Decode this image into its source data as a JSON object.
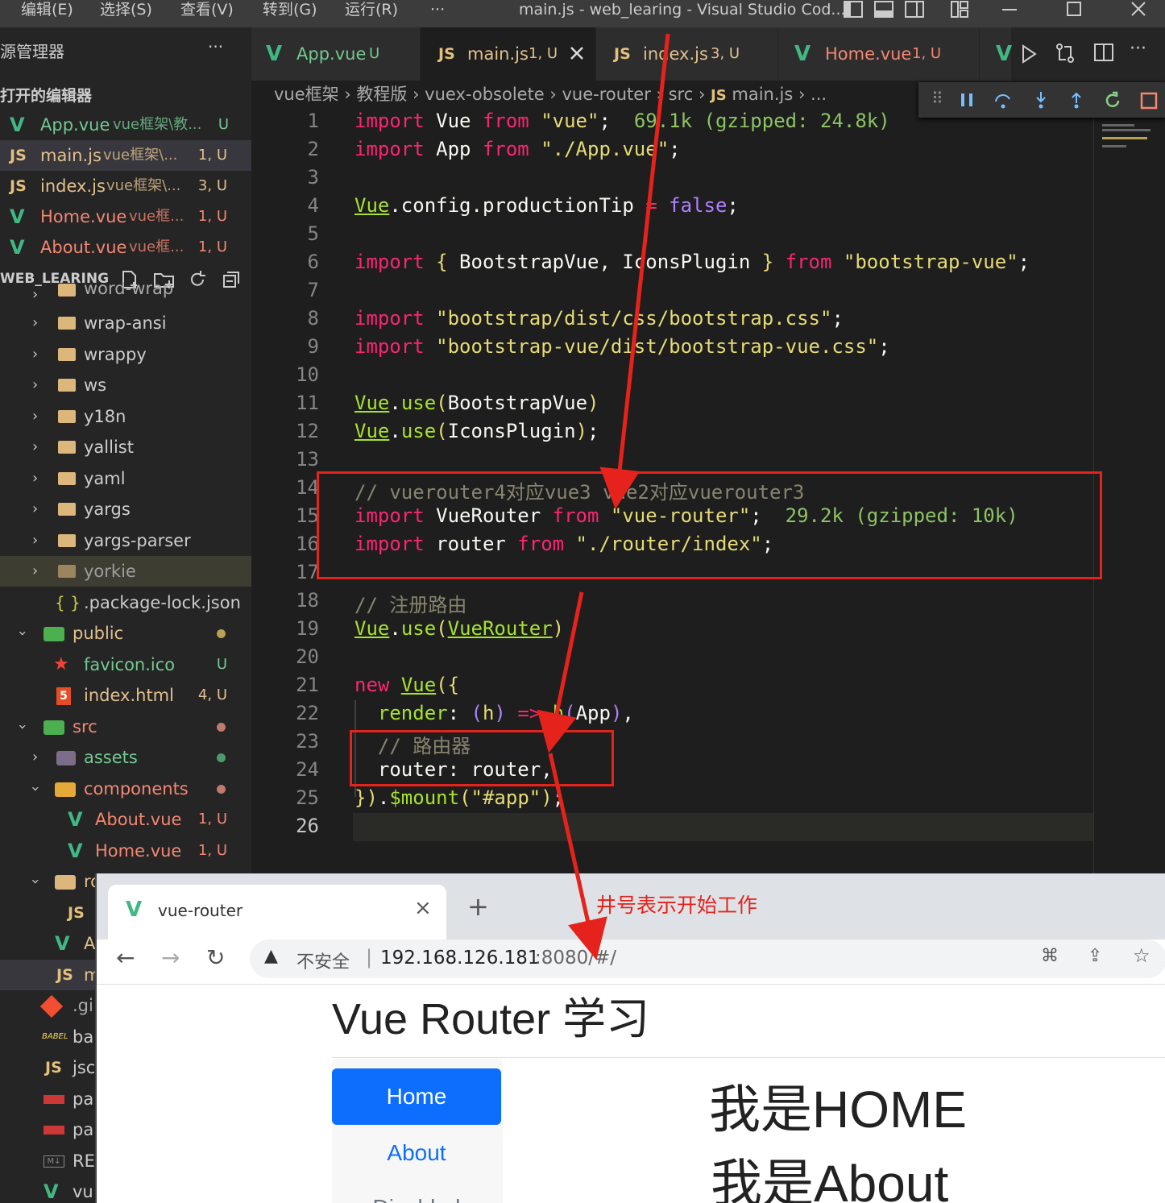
{
  "titlebar": {
    "menus": [
      "编辑(E)",
      "选择(S)",
      "查看(V)",
      "转到(G)",
      "运行(R)",
      "···"
    ],
    "window_title": "main.js - web_learing - Visual Studio Cod..."
  },
  "sidebar": {
    "header": "源管理器",
    "header_more": "···",
    "open_editors_label": "打开的编辑器",
    "open_editors": [
      {
        "icon": "V",
        "name": "App.vue",
        "path": "vue框架\\教...",
        "badge": "U",
        "color": "#73c991"
      },
      {
        "icon": "JS",
        "name": "main.js",
        "path": "vue框架\\...",
        "badge": "1, U",
        "color": "#e2c08d"
      },
      {
        "icon": "JS",
        "name": "index.js",
        "path": "vue框架\\...",
        "badge": "3, U",
        "color": "#e2c08d"
      },
      {
        "icon": "V",
        "name": "Home.vue",
        "path": "vue框...",
        "badge": "1, U",
        "color": "#f48771"
      },
      {
        "icon": "V",
        "name": "About.vue",
        "path": "vue框...",
        "badge": "1, U",
        "color": "#f48771"
      }
    ],
    "project_label": "WEB_LEARING",
    "tree": [
      {
        "name": "word-wrap",
        "type": "folder"
      },
      {
        "name": "wrap-ansi",
        "type": "folder"
      },
      {
        "name": "wrappy",
        "type": "folder"
      },
      {
        "name": "ws",
        "type": "folder"
      },
      {
        "name": "y18n",
        "type": "folder"
      },
      {
        "name": "yallist",
        "type": "folder"
      },
      {
        "name": "yaml",
        "type": "folder"
      },
      {
        "name": "yargs",
        "type": "folder"
      },
      {
        "name": "yargs-parser",
        "type": "folder"
      },
      {
        "name": "yorkie",
        "type": "folder"
      },
      {
        "name": ".package-lock.json",
        "type": "json"
      },
      {
        "name": "public",
        "type": "folder-open"
      },
      {
        "name": "favicon.ico",
        "type": "ico",
        "badge": "U"
      },
      {
        "name": "index.html",
        "type": "html",
        "badge": "4, U"
      },
      {
        "name": "src",
        "type": "folder-open"
      },
      {
        "name": "assets",
        "type": "folder"
      },
      {
        "name": "components",
        "type": "folder-open"
      },
      {
        "name": "About.vue",
        "type": "vue",
        "badge": "1, U"
      },
      {
        "name": "Home.vue",
        "type": "vue",
        "badge": "1, U"
      },
      {
        "name": "ro",
        "type": "folder-open"
      },
      {
        "name": "JS",
        "type": "js"
      },
      {
        "name": "A",
        "type": "vue"
      },
      {
        "name": "m",
        "type": "js"
      },
      {
        "name": ".gi",
        "type": "git"
      },
      {
        "name": "ba",
        "type": "babel"
      },
      {
        "name": "jsc",
        "type": "js"
      },
      {
        "name": "pa",
        "type": "npm"
      },
      {
        "name": "pa",
        "type": "npm"
      },
      {
        "name": "RE",
        "type": "md"
      },
      {
        "name": "vu",
        "type": "vue"
      }
    ]
  },
  "tabs": [
    {
      "icon": "V",
      "name": "App.vue",
      "badge": "U",
      "active": false
    },
    {
      "icon": "JS",
      "name": "main.js",
      "badge": "1, U",
      "active": true
    },
    {
      "icon": "JS",
      "name": "index.js",
      "badge": "3, U",
      "active": false
    },
    {
      "icon": "V",
      "name": "Home.vue",
      "badge": "1, U",
      "active": false
    }
  ],
  "breadcrumb": [
    "vue框架",
    "教程版",
    "vuex-obsolete",
    "vue-router",
    "src",
    "main.js",
    "..."
  ],
  "code_lines": [
    "1",
    "2",
    "3",
    "4",
    "5",
    "6",
    "7",
    "8",
    "9",
    "10",
    "11",
    "12",
    "13",
    "14",
    "15",
    "16",
    "17",
    "18",
    "19",
    "20",
    "21",
    "22",
    "23",
    "24",
    "25",
    "26"
  ],
  "code": {
    "l1_hint": "69.1k (gzipped: 24.8k)",
    "l15_hint": "29.2k (gzipped: 10k)",
    "l14_comment": "// vuerouter4对应vue3 vue2对应vuerouter3",
    "l18_comment": "// 注册路由",
    "l23_comment": "// 路由器"
  },
  "browser": {
    "tab_title": "vue-router",
    "tab_close": "×",
    "new_tab": "+",
    "insecure_label": "不安全",
    "url_host": "192.168.126.181",
    "url_rest": ":8080/#/",
    "page_title": "Vue Router 学习",
    "nav": [
      "Home",
      "About",
      "Disabled"
    ],
    "content": [
      "我是HOME",
      "我是About"
    ]
  },
  "annotation": {
    "note": "井号表示开始工作",
    "color": "#e5221b"
  }
}
